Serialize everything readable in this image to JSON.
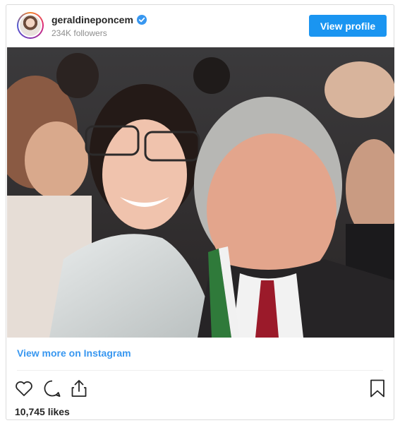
{
  "post": {
    "username": "geraldineponcem",
    "followers": "234K followers",
    "view_profile_label": "View profile",
    "view_more_label": "View more on Instagram",
    "likes": "10,745 likes"
  },
  "icons": {
    "verified": "verified-badge-icon",
    "like": "heart-icon",
    "comment": "comment-icon",
    "share": "share-icon",
    "save": "bookmark-icon"
  },
  "colors": {
    "accent": "#1a95f1",
    "link": "#3897f0",
    "muted": "#8e8e8e",
    "border": "#dbdbdb"
  }
}
